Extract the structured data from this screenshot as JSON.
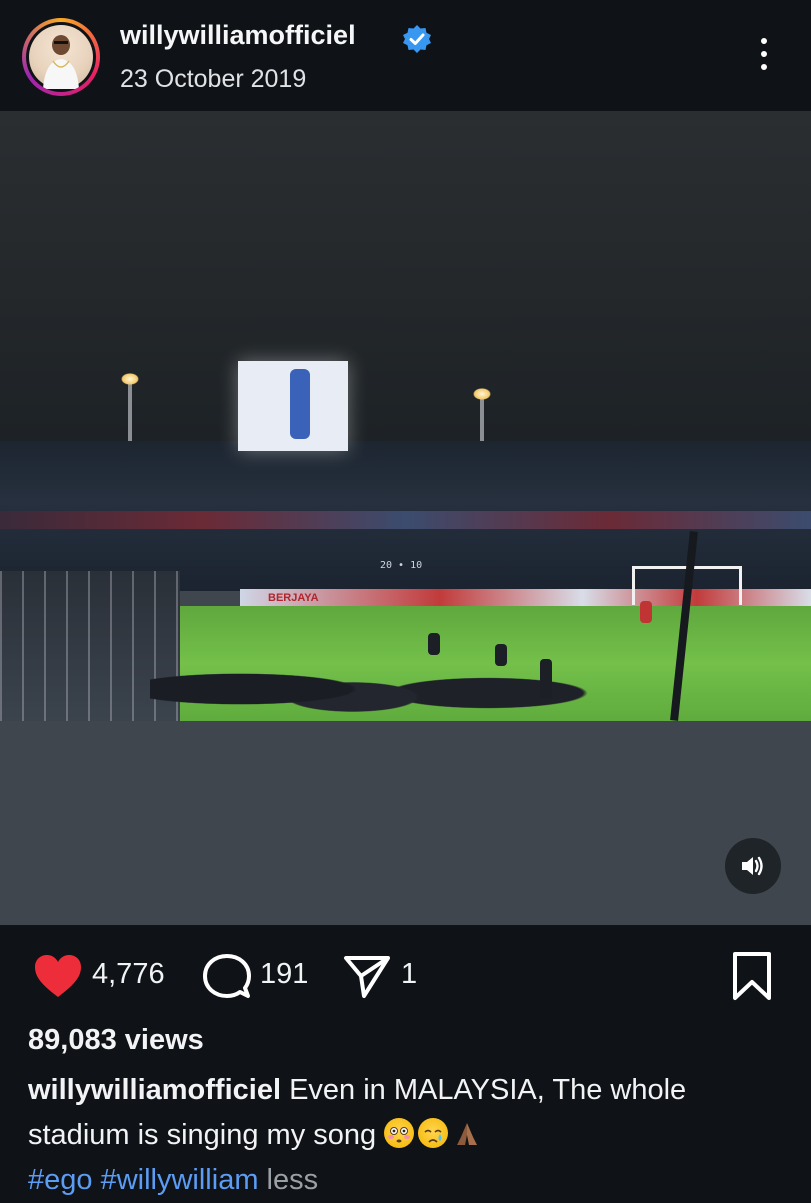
{
  "post": {
    "username": "willywilliamofficiel",
    "date": "23 October 2019",
    "verified": true
  },
  "media": {
    "type": "video",
    "scoreboard_text": "20 • 10",
    "hoarding_text": "BERJAYA",
    "sound_button": "speaker-icon"
  },
  "actions": {
    "likes": "4,776",
    "comments": "191",
    "shares": "1"
  },
  "stats": {
    "views": "89,083 views"
  },
  "caption": {
    "username": "willywilliamofficiel",
    "text": "Even in MALAYSIA, The whole stadium is singing my song",
    "emojis": [
      "flushed-face",
      "crying-face",
      "folded-hands"
    ],
    "hashtags": [
      "#ego",
      "#willywilliam"
    ],
    "less_label": "less"
  },
  "colors": {
    "background": "#0f1216",
    "like_red": "#ee2d3b",
    "hashtag_blue": "#5b9cf5",
    "verified_blue": "#3897f0"
  }
}
